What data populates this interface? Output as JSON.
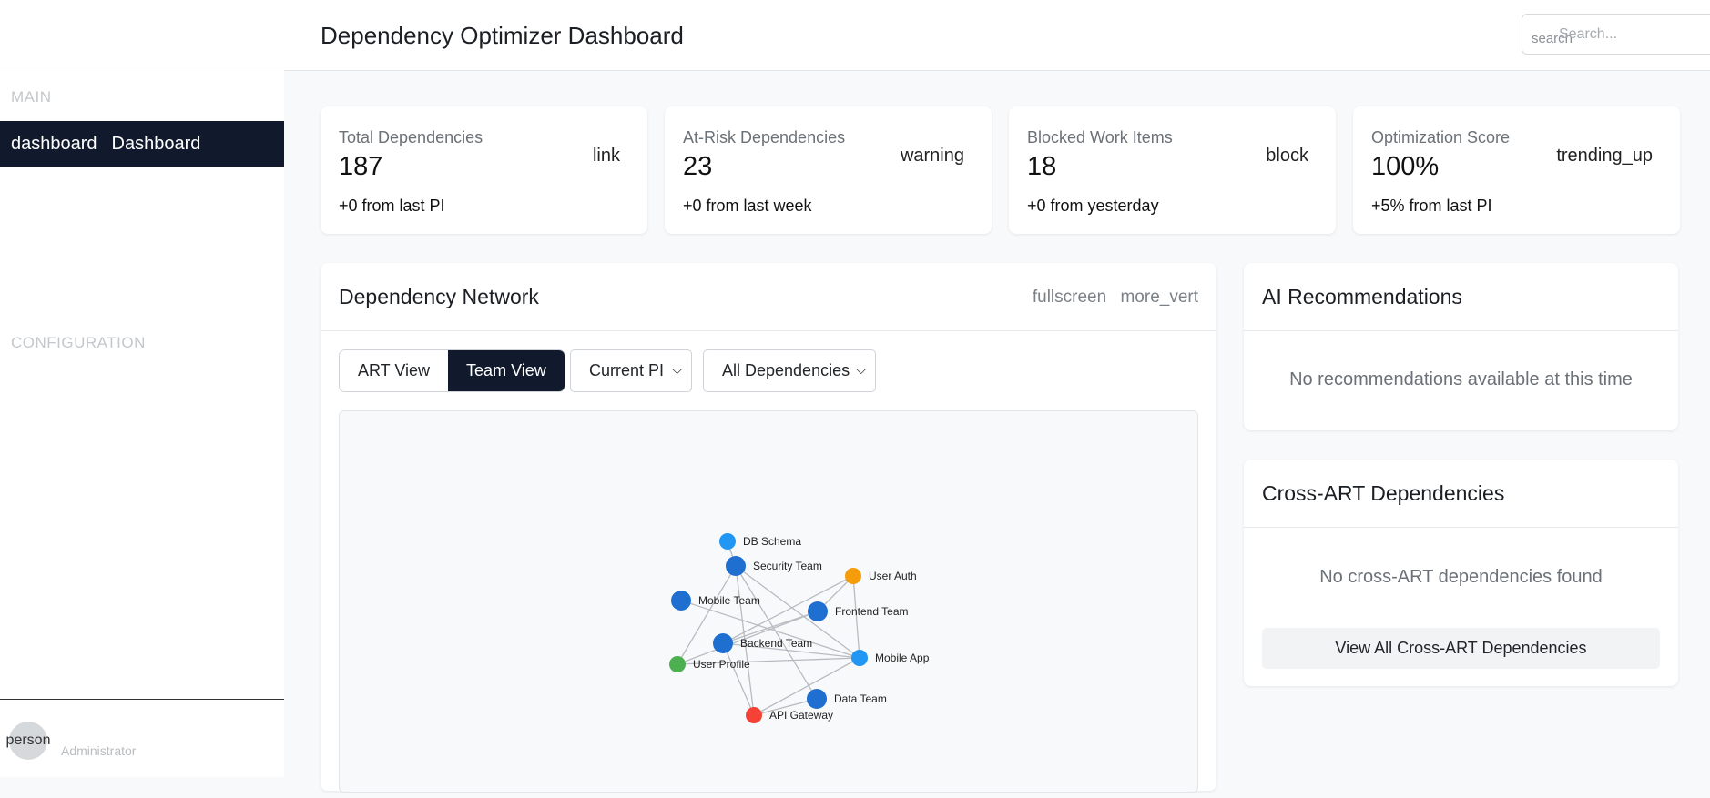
{
  "sidebar": {
    "sections": {
      "main": "MAIN",
      "configuration": "CONFIGURATION"
    },
    "items": [
      {
        "icon": "dashboard",
        "label": "Dashboard"
      }
    ],
    "user": {
      "avatar_icon": "person",
      "role": "Administrator"
    }
  },
  "header": {
    "title": "Dependency Optimizer Dashboard",
    "search": {
      "icon": "search",
      "placeholder": "Search..."
    }
  },
  "stats": [
    {
      "label": "Total Dependencies",
      "value": "187",
      "icon": "link",
      "change": "+0 from last PI"
    },
    {
      "label": "At-Risk Dependencies",
      "value": "23",
      "icon": "warning",
      "change": "+0 from last week"
    },
    {
      "label": "Blocked Work Items",
      "value": "18",
      "icon": "block",
      "change": "+0 from yesterday"
    },
    {
      "label": "Optimization Score",
      "value": "100%",
      "icon": "trending_up",
      "change": "+5% from last PI"
    }
  ],
  "network": {
    "title": "Dependency Network",
    "icons": {
      "fullscreen": "fullscreen",
      "menu": "more_vert"
    },
    "view_toggle": [
      {
        "label": "ART View"
      },
      {
        "label": "Team View"
      }
    ],
    "pi_filter": "Current PI",
    "dep_filter": "All Dependencies",
    "colors": {
      "team": "#1f6fd1",
      "component": "#2196f3",
      "orange": "#f59c0b",
      "green": "#4caf50",
      "red": "#f44336"
    },
    "nodes": [
      {
        "id": "db",
        "label": "DB Schema",
        "kind": "component"
      },
      {
        "id": "sec",
        "label": "Security Team",
        "kind": "team"
      },
      {
        "id": "auth",
        "label": "User Auth",
        "kind": "orange"
      },
      {
        "id": "mob",
        "label": "Mobile Team",
        "kind": "team"
      },
      {
        "id": "fe",
        "label": "Frontend Team",
        "kind": "team"
      },
      {
        "id": "be",
        "label": "Backend Team",
        "kind": "team"
      },
      {
        "id": "prof",
        "label": "User Profile",
        "kind": "green"
      },
      {
        "id": "app",
        "label": "Mobile App",
        "kind": "component"
      },
      {
        "id": "data",
        "label": "Data Team",
        "kind": "team"
      },
      {
        "id": "api",
        "label": "API Gateway",
        "kind": "red"
      }
    ],
    "edges": [
      [
        "db",
        "sec"
      ],
      [
        "sec",
        "app"
      ],
      [
        "sec",
        "data"
      ],
      [
        "sec",
        "api"
      ],
      [
        "sec",
        "prof"
      ],
      [
        "auth",
        "fe"
      ],
      [
        "auth",
        "app"
      ],
      [
        "auth",
        "be"
      ],
      [
        "mob",
        "app"
      ],
      [
        "fe",
        "be"
      ],
      [
        "be",
        "api"
      ],
      [
        "be",
        "app"
      ],
      [
        "prof",
        "app"
      ],
      [
        "prof",
        "fe"
      ],
      [
        "api",
        "app"
      ],
      [
        "api",
        "data"
      ]
    ]
  },
  "recommendations": {
    "title": "AI Recommendations",
    "empty": "No recommendations available at this time"
  },
  "cross_art": {
    "title": "Cross-ART Dependencies",
    "empty": "No cross-ART dependencies found",
    "view_all": "View All Cross-ART Dependencies"
  }
}
